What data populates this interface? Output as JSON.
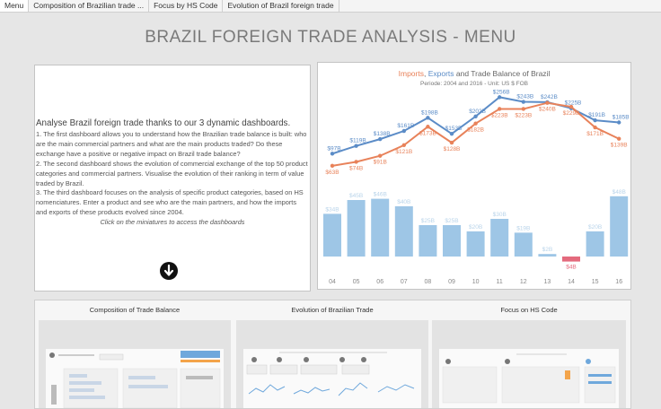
{
  "tabs": [
    "Menu",
    "Composition of Brazilian trade ...",
    "Focus by HS Code",
    "Evolution of Brazil foreign trade"
  ],
  "page_title": "BRAZIL FOREIGN TRADE ANALYSIS - MENU",
  "intro": {
    "heading": "Analyse Brazil foreign trade thanks to our 3 dynamic dashboards.",
    "p1": "1. The first dashboard allows you to understand how the Brazilian trade balance is built: who are the main commercial partners and what are the main products traded? Do these exchange have a positive or negative impact on Brazil trade balance?",
    "p2": "2. The second dashboard shows the evolution of commercial exchange of the top 50 product categories and commercial partners. Visualise the evolution of their ranking in term of value traded by Brazil.",
    "p3": "3. The third  dashboard focuses on the analysis of specific product categories, based on HS nomenciatures. Enter a product and see who are the main partners, and how the imports and exports of these products evolved since 2004.",
    "note": "Click on the miniatures to access the dashboards",
    "button_icon": "arrow-down-circle-icon"
  },
  "colors": {
    "imports": "#e8825a",
    "exports": "#5b8cc7",
    "balance_pos": "#9ec6e6",
    "balance_neg": "#e46a7d"
  },
  "chart_data": {
    "type": "line",
    "title_parts": [
      "Imports",
      ", ",
      "Exports",
      " and Trade Balance of Brazil"
    ],
    "subtitle": "Periode: 2004 and 2016 - Unit: US $ FOB",
    "categories": [
      "04",
      "05",
      "06",
      "07",
      "08",
      "09",
      "10",
      "11",
      "12",
      "13",
      "14",
      "15",
      "16"
    ],
    "series": [
      {
        "name": "Exports",
        "values": [
          97,
          119,
          138,
          161,
          198,
          153,
          202,
          256,
          243,
          242,
          225,
          191,
          185
        ],
        "labels": [
          "$97B",
          "$119B",
          "$138B",
          "$161B",
          "$198B",
          "$153B",
          "$202B",
          "$256B",
          "$243B",
          "$242B",
          "$225B",
          "$191B",
          "$185B"
        ]
      },
      {
        "name": "Imports",
        "values": [
          63,
          74,
          91,
          121,
          173,
          128,
          182,
          223,
          223,
          240,
          229,
          171,
          139
        ],
        "labels": [
          "$63B",
          "$74B",
          "$91B",
          "$121B",
          "$173B",
          "$128B",
          "$182B",
          "$223B",
          "$223B",
          "$240B",
          "$229B",
          "$171B",
          "$139B"
        ]
      }
    ],
    "balance": {
      "values": [
        34,
        45,
        46,
        40,
        25,
        25,
        20,
        30,
        19,
        2,
        -4,
        20,
        48
      ],
      "labels": [
        "$34B",
        "$45B",
        "$46B",
        "$40B",
        "$25B",
        "$25B",
        "$20B",
        "$30B",
        "$19B",
        "$2B",
        "$4B",
        "$20B",
        "$48B"
      ]
    }
  },
  "miniatures": [
    {
      "title": "Composition of Trade Balance"
    },
    {
      "title": "Evolution of Brazilian Trade"
    },
    {
      "title": "Focus on HS Code"
    }
  ]
}
